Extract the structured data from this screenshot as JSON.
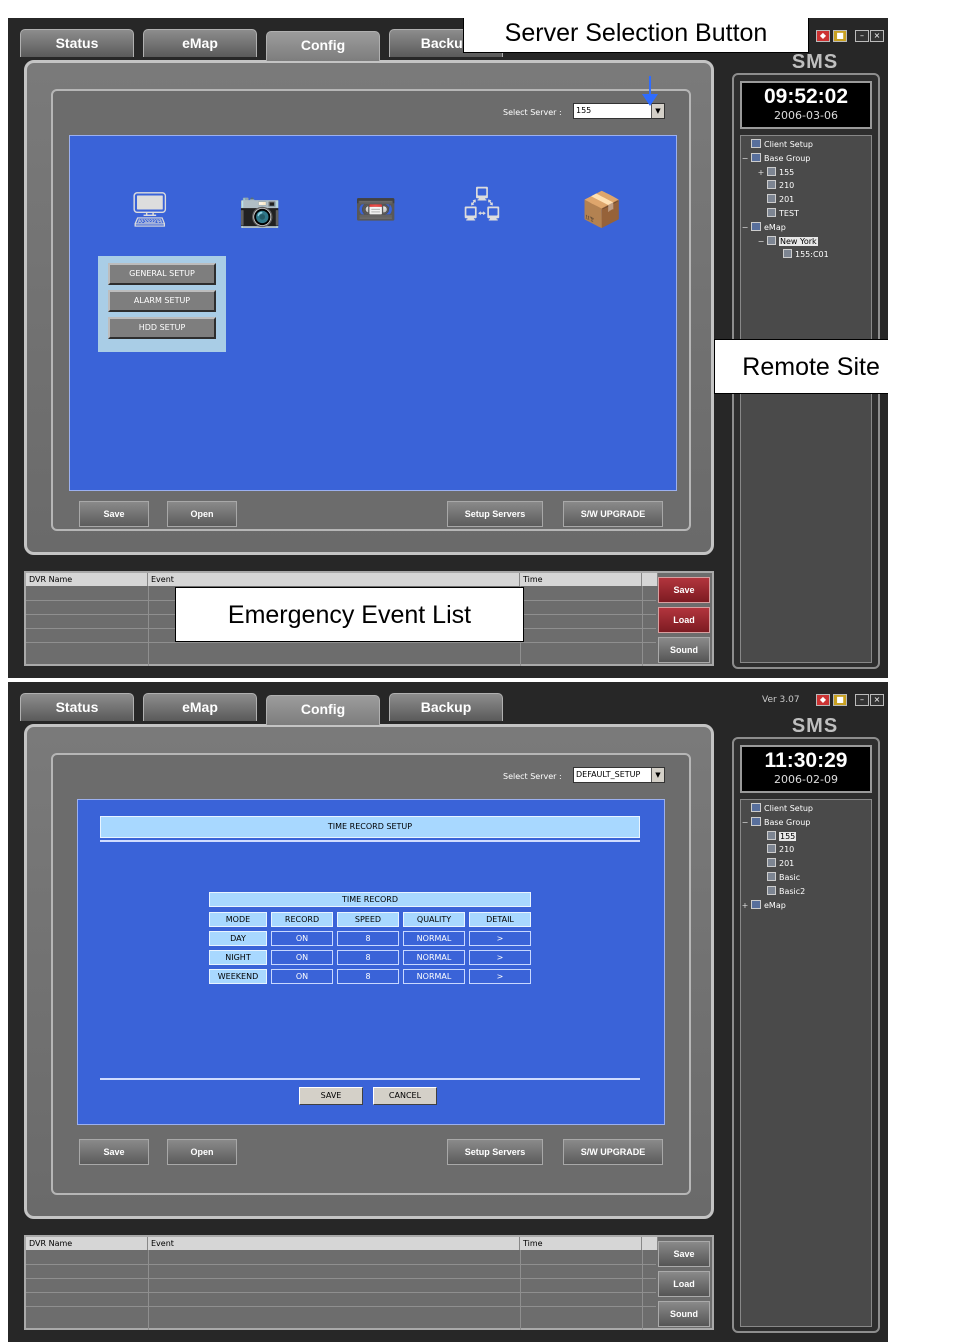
{
  "tabs": [
    "Status",
    "eMap",
    "Config",
    "Backup"
  ],
  "app_title": "SMS",
  "version": "Ver 3.07",
  "select_server_label": "Select Server :",
  "bottom_buttons": {
    "save": "Save",
    "open": "Open",
    "setup_servers": "Setup Servers",
    "sw_upgrade": "S/W UPGRADE"
  },
  "event_columns": [
    "DVR Name",
    "Event",
    "Time"
  ],
  "event_buttons": [
    "Save",
    "Load",
    "Sound"
  ],
  "icons": [
    "general-setup-icon",
    "camera-icon",
    "recording-icon",
    "network-icon",
    "system-icon"
  ],
  "panel1": {
    "select_server_value": "155",
    "menu_buttons": [
      "GENERAL SETUP",
      "ALARM SETUP",
      "HDD SETUP"
    ],
    "clock": {
      "time": "09:52:02",
      "date": "2006-03-06"
    },
    "tree": [
      {
        "level": 0,
        "pm": "",
        "label": "Client Setup",
        "highlight": false
      },
      {
        "level": 0,
        "pm": "−",
        "label": "Base Group",
        "highlight": false
      },
      {
        "level": 1,
        "pm": "+",
        "label": "155",
        "highlight": false
      },
      {
        "level": 1,
        "pm": "",
        "label": "210",
        "highlight": false
      },
      {
        "level": 1,
        "pm": "",
        "label": "201",
        "highlight": false
      },
      {
        "level": 1,
        "pm": "",
        "label": "TEST",
        "highlight": false
      },
      {
        "level": 0,
        "pm": "−",
        "label": "eMap",
        "highlight": false
      },
      {
        "level": 1,
        "pm": "−",
        "label": "New York",
        "highlight": true
      },
      {
        "level": 2,
        "pm": "",
        "label": "155:C01",
        "highlight": false
      }
    ],
    "callouts": {
      "server": "Server Selection Button",
      "remote": "Remote Site List",
      "emergency": "Emergency Event List"
    }
  },
  "panel2": {
    "select_server_value": "DEFAULT_SETUP",
    "setup_title": "TIME RECORD SETUP",
    "table_title": "TIME RECORD",
    "table_columns": [
      "MODE",
      "RECORD",
      "SPEED",
      "QUALITY",
      "DETAIL"
    ],
    "table_rows": [
      [
        "DAY",
        "ON",
        "8",
        "NORMAL",
        ">"
      ],
      [
        "NIGHT",
        "ON",
        "8",
        "NORMAL",
        ">"
      ],
      [
        "WEEKEND",
        "ON",
        "8",
        "NORMAL",
        ">"
      ]
    ],
    "save_label": "SAVE",
    "cancel_label": "CANCEL",
    "clock": {
      "time": "11:30:29",
      "date": "2006-02-09"
    },
    "tree": [
      {
        "level": 0,
        "pm": "",
        "label": "Client Setup",
        "highlight": false
      },
      {
        "level": 0,
        "pm": "−",
        "label": "Base Group",
        "highlight": false
      },
      {
        "level": 1,
        "pm": "",
        "label": "155",
        "highlight": true
      },
      {
        "level": 1,
        "pm": "",
        "label": "210",
        "highlight": false
      },
      {
        "level": 1,
        "pm": "",
        "label": "201",
        "highlight": false
      },
      {
        "level": 1,
        "pm": "",
        "label": "Basic",
        "highlight": false
      },
      {
        "level": 1,
        "pm": "",
        "label": "Basic2",
        "highlight": false
      },
      {
        "level": 0,
        "pm": "+",
        "label": "eMap",
        "highlight": false
      }
    ]
  },
  "colors": {
    "accent_blue": "#3a63d8",
    "save_red": "#9b2730",
    "arrow_blue": "#2f6cff"
  }
}
